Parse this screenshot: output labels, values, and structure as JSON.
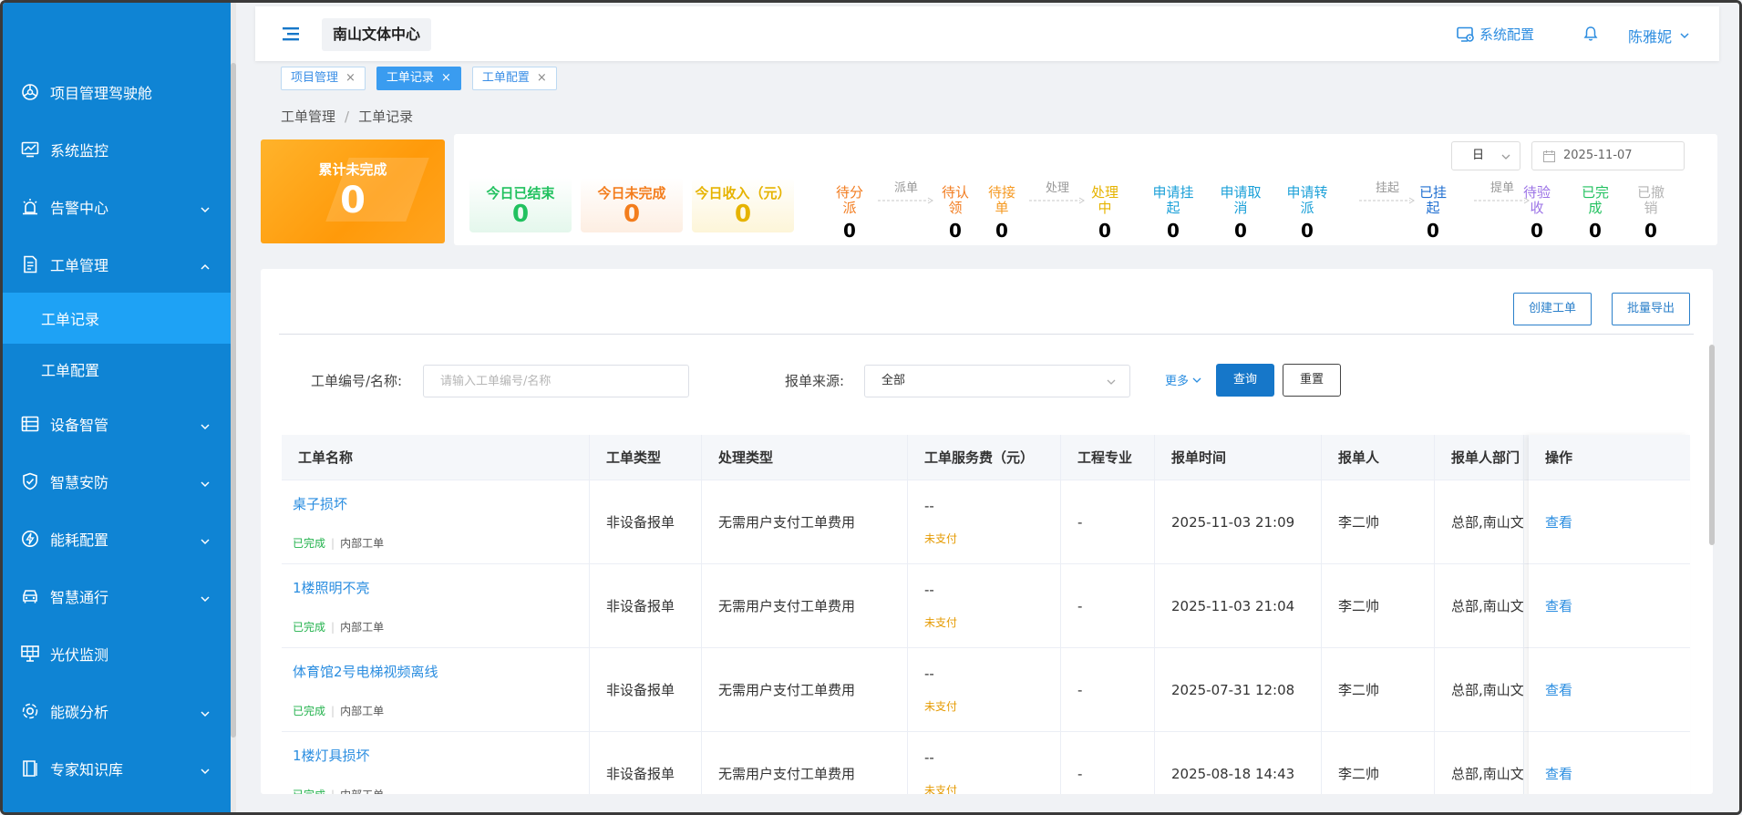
{
  "sidebar": {
    "items": [
      {
        "label": "项目管理驾驶舱",
        "icon": "dashboard-icon"
      },
      {
        "label": "系统监控",
        "icon": "monitor-chart-icon"
      },
      {
        "label": "告警中心",
        "icon": "alarm-icon",
        "expandable": true
      },
      {
        "label": "工单管理",
        "icon": "document-icon",
        "expanded": true
      },
      {
        "label": "工单记录",
        "sub": true,
        "active": true
      },
      {
        "label": "工单配置",
        "sub": true
      },
      {
        "label": "设备智管",
        "icon": "device-list-icon",
        "expandable": true
      },
      {
        "label": "智慧安防",
        "icon": "shield-check-icon",
        "expandable": true
      },
      {
        "label": "能耗配置",
        "icon": "energy-icon",
        "expandable": true
      },
      {
        "label": "智慧通行",
        "icon": "car-icon",
        "expandable": true
      },
      {
        "label": "光伏监测",
        "icon": "solar-panel-icon"
      },
      {
        "label": "能碳分析",
        "icon": "carbon-icon",
        "expandable": true
      },
      {
        "label": "专家知识库",
        "icon": "book-icon",
        "expandable": true
      }
    ]
  },
  "header": {
    "site_name": "南山文体中心",
    "system_config": "系统配置",
    "user_name": "陈雅妮"
  },
  "tabs": [
    {
      "label": "项目管理",
      "active": false
    },
    {
      "label": "工单记录",
      "active": true
    },
    {
      "label": "工单配置",
      "active": false
    }
  ],
  "tab_close": "×",
  "breadcrumb": {
    "parent": "工单管理",
    "separator": "/",
    "current": "工单记录"
  },
  "summary": {
    "accum_label": "累计未完成",
    "accum_value": "0",
    "cards": [
      {
        "label": "今日已结束",
        "value": "0"
      },
      {
        "label": "今日未完成",
        "value": "0"
      },
      {
        "label": "今日收入（元）",
        "value": "0"
      }
    ],
    "steps": [
      {
        "label": "待分\n派",
        "value": "0",
        "color": "#f27c1f"
      },
      {
        "label": "待认\n领",
        "value": "0",
        "color": "#f27c1f"
      },
      {
        "label": "待接\n单",
        "value": "0",
        "color": "#f59a23"
      },
      {
        "label": "处理\n中",
        "value": "0",
        "color": "#e6b300"
      },
      {
        "label": "申请挂\n起",
        "value": "0",
        "color": "#1ba0d8"
      },
      {
        "label": "申请取\n消",
        "value": "0",
        "color": "#1ba0d8"
      },
      {
        "label": "申请转\n派",
        "value": "0",
        "color": "#1ba0d8"
      },
      {
        "label": "已挂\n起",
        "value": "0",
        "color": "#1f6fd1"
      },
      {
        "label": "待验\n收",
        "value": "0",
        "color": "#9b72e6"
      },
      {
        "label": "已完\n成",
        "value": "0",
        "color": "#21c15f"
      },
      {
        "label": "已撤\n销",
        "value": "0",
        "color": "#b5b5b5"
      }
    ],
    "flows": [
      "派单",
      "处理",
      "挂起",
      "提单"
    ],
    "period": "日",
    "date": "2025-11-07"
  },
  "toolbar": {
    "create": "创建工单",
    "export": "批量导出"
  },
  "filters": {
    "id_label": "工单编号/名称:",
    "id_placeholder": "请输入工单编号/名称",
    "source_label": "报单来源:",
    "source_value": "全部",
    "more": "更多",
    "query": "查询",
    "reset": "重置"
  },
  "table": {
    "columns": [
      "工单名称",
      "工单类型",
      "处理类型",
      "工单服务费（元）",
      "工程专业",
      "报单时间",
      "报单人",
      "报单人部门",
      "操作"
    ],
    "rows": [
      {
        "name": "桌子损坏",
        "status": "已完成",
        "category": "内部工单",
        "type": "非设备报单",
        "handle": "无需用户支付工单费用",
        "fee": "--",
        "pay": "未支付",
        "major": "-",
        "time": "2025-11-03 21:09",
        "reporter": "李二帅",
        "dept": "总部,南山文体中心",
        "op": "查看"
      },
      {
        "name": "1楼照明不亮",
        "status": "已完成",
        "category": "内部工单",
        "type": "非设备报单",
        "handle": "无需用户支付工单费用",
        "fee": "--",
        "pay": "未支付",
        "major": "-",
        "time": "2025-11-03 21:04",
        "reporter": "李二帅",
        "dept": "总部,南山文体中心",
        "op": "查看"
      },
      {
        "name": "体育馆2号电梯视频离线",
        "status": "已完成",
        "category": "内部工单",
        "type": "非设备报单",
        "handle": "无需用户支付工单费用",
        "fee": "--",
        "pay": "未支付",
        "major": "-",
        "time": "2025-07-31 12:08",
        "reporter": "李二帅",
        "dept": "总部,南山文体中心",
        "op": "查看"
      },
      {
        "name": "1楼灯具损坏",
        "status": "已完成",
        "category": "内部工单",
        "type": "非设备报单",
        "handle": "无需用户支付工单费用",
        "fee": "--",
        "pay": "未支付",
        "major": "-",
        "time": "2025-08-18 14:43",
        "reporter": "李二帅",
        "dept": "总部,南山文体中心",
        "op": "查看"
      }
    ]
  }
}
